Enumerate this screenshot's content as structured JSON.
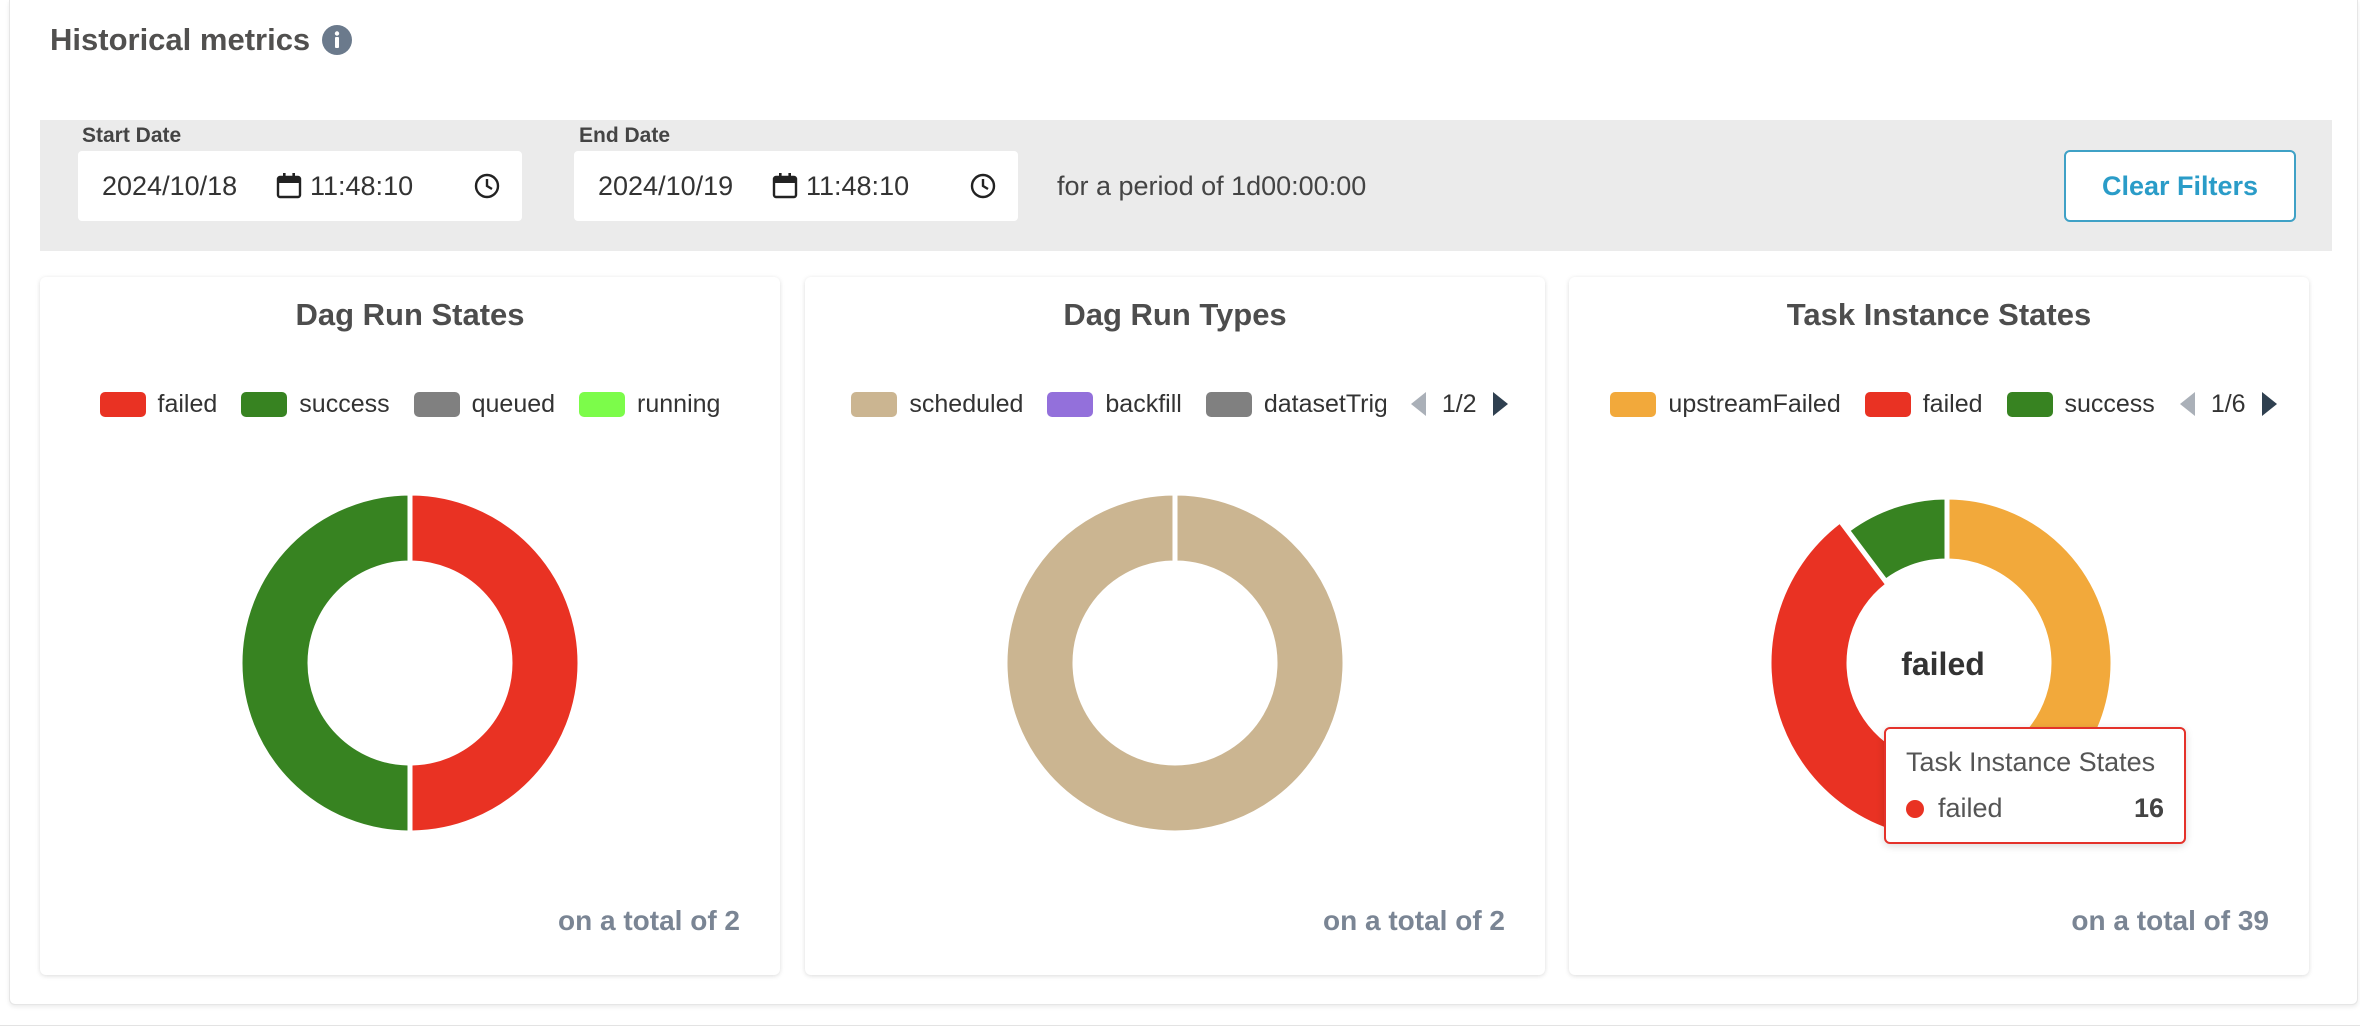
{
  "header": {
    "title": "Historical metrics",
    "info_icon": "info-icon"
  },
  "filters": {
    "start_label": "Start Date",
    "start_date": "2024/10/18",
    "start_time": "11:48:10",
    "end_label": "End Date",
    "end_date": "2024/10/19",
    "end_time": "11:48:10",
    "period_text": "for a period of 1d00:00:00",
    "clear_label": "Clear Filters"
  },
  "colors": {
    "failed": "#e93223",
    "success": "#378321",
    "queued": "#808080",
    "running": "#7cfc4a",
    "scheduled": "#cbb591",
    "backfill": "#9370db",
    "datasetTriggered": "#808080",
    "upstreamFailed": "#f2a93b"
  },
  "chart_data": [
    {
      "type": "pie",
      "title": "Dag Run States",
      "legend": [
        "failed",
        "success",
        "queued",
        "running"
      ],
      "slices": [
        {
          "label": "failed",
          "value": 1
        },
        {
          "label": "success",
          "value": 1
        }
      ],
      "footer": "on a total of 2"
    },
    {
      "type": "pie",
      "title": "Dag Run Types",
      "legend": [
        "scheduled",
        "backfill",
        "datasetTriggered"
      ],
      "legend_page": "1/2",
      "slices": [
        {
          "label": "scheduled",
          "value": 2
        }
      ],
      "footer": "on a total of 2"
    },
    {
      "type": "pie",
      "title": "Task Instance States",
      "legend": [
        "upstreamFailed",
        "failed",
        "success"
      ],
      "legend_page": "1/6",
      "slices": [
        {
          "label": "upstreamFailed",
          "value": 19
        },
        {
          "label": "failed",
          "value": 16
        },
        {
          "label": "success",
          "value": 4
        }
      ],
      "center_label": "failed",
      "tooltip": {
        "title": "Task Instance States",
        "label": "failed",
        "value": "16"
      },
      "footer": "on a total of 39"
    }
  ]
}
